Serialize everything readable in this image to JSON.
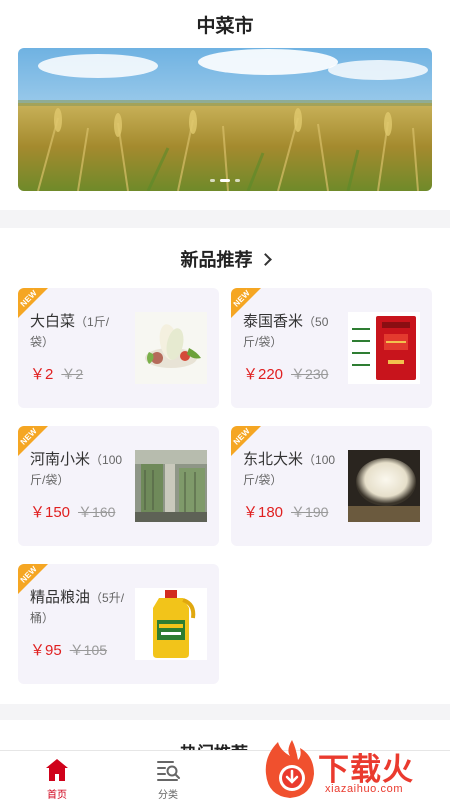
{
  "header": {
    "title": "中菜市"
  },
  "banner": {
    "slide_count": 3,
    "active_slide": 2
  },
  "new_section": {
    "title": "新品推荐"
  },
  "products": [
    {
      "badge": "NEW",
      "name": "大白菜",
      "unit": "（1斤/袋）",
      "price": "￥2",
      "old_price": "￥2",
      "image_icon": "cabbage-image"
    },
    {
      "badge": "NEW",
      "name": "泰国香米",
      "unit": "（50斤/袋）",
      "price": "￥220",
      "old_price": "￥230",
      "image_icon": "rice-bag-image"
    },
    {
      "badge": "NEW",
      "name": "河南小米",
      "unit": "（100斤/袋）",
      "price": "￥150",
      "old_price": "￥160",
      "image_icon": "warehouse-image"
    },
    {
      "badge": "NEW",
      "name": "东北大米",
      "unit": "（100斤/袋）",
      "price": "￥180",
      "old_price": "￥190",
      "image_icon": "rice-grains-image"
    },
    {
      "badge": "NEW",
      "name": "精品粮油",
      "unit": "（5升/桶）",
      "price": "￥95",
      "old_price": "￥105",
      "image_icon": "oil-bottle-image"
    }
  ],
  "hot_section": {
    "title": "热门推荐"
  },
  "tabbar": {
    "items": [
      {
        "label": "首页",
        "icon": "home-icon",
        "active": true
      },
      {
        "label": "分类",
        "icon": "category-icon",
        "active": false
      }
    ]
  },
  "watermark": {
    "text": "下载火",
    "url": "xiazaihuo.com"
  },
  "colors": {
    "accent": "#e02020",
    "badge": "#f5a623",
    "card_bg": "#f5f3fa",
    "tab_active": "#d0021b"
  }
}
